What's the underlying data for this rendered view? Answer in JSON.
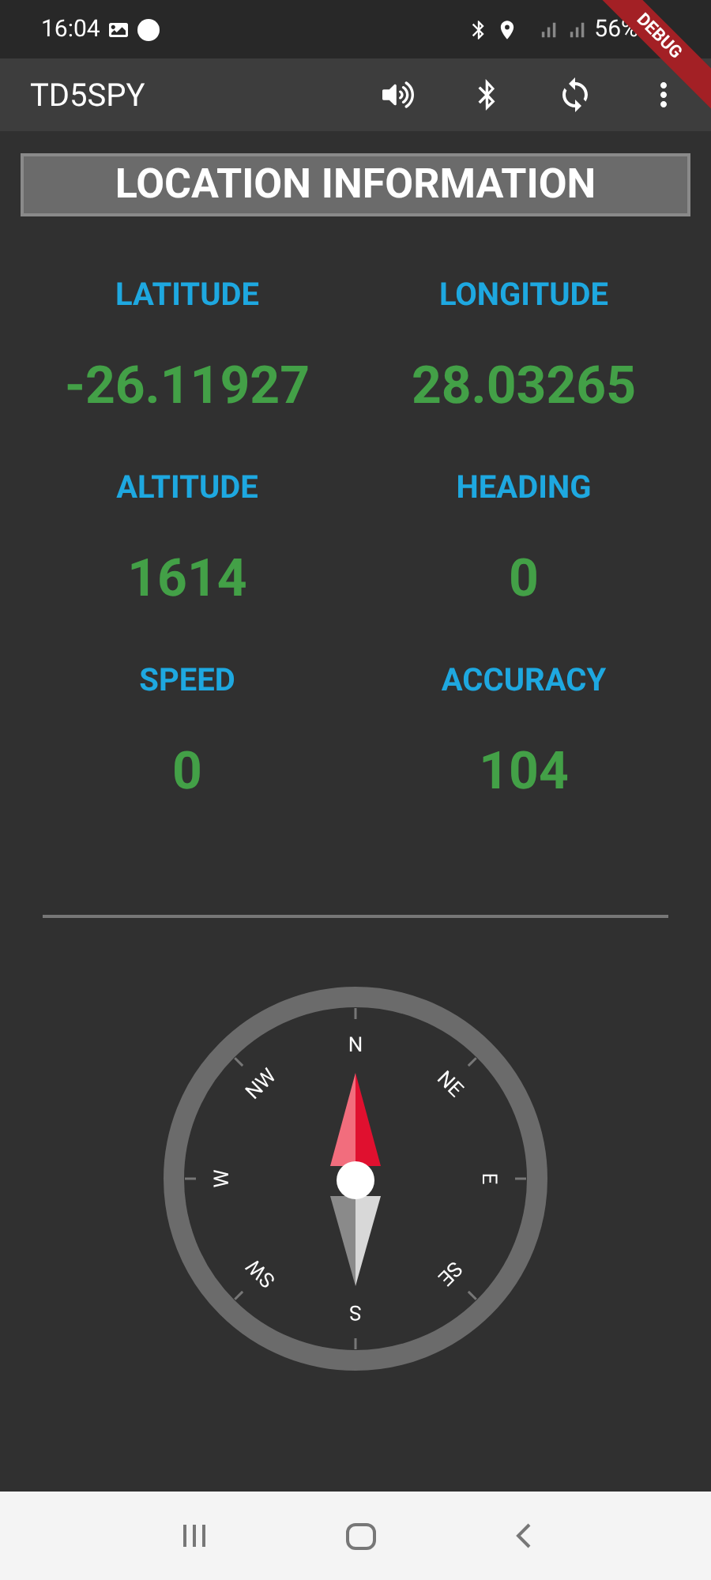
{
  "status_bar": {
    "time": "16:04",
    "battery": "56%"
  },
  "debug_banner": "DEBUG",
  "app_bar": {
    "title": "TD5SPY"
  },
  "banner": "LOCATION INFORMATION",
  "readings": [
    {
      "label": "LATITUDE",
      "value": "-26.11927"
    },
    {
      "label": "LONGITUDE",
      "value": "28.03265"
    },
    {
      "label": "ALTITUDE",
      "value": "1614"
    },
    {
      "label": "HEADING",
      "value": "0"
    },
    {
      "label": "SPEED",
      "value": "0"
    },
    {
      "label": "ACCURACY",
      "value": "104"
    }
  ],
  "compass": {
    "labels": [
      "N",
      "NE",
      "E",
      "SE",
      "S",
      "SW",
      "W",
      "NW"
    ]
  }
}
